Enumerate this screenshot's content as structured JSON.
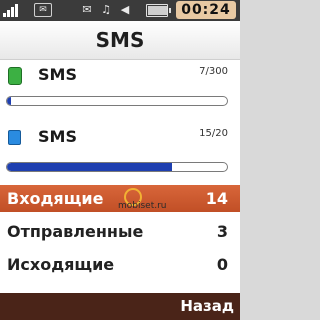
{
  "status_bar": {
    "time": "00:24",
    "signal_level": 4,
    "battery_level": 0.95,
    "icons": [
      "signal-icon",
      "message-indicator-icon",
      "mail-icon",
      "music-icon",
      "speaker-icon",
      "battery-icon"
    ]
  },
  "header": {
    "title": "SMS"
  },
  "storage": [
    {
      "label": "SMS",
      "count": "7/300",
      "icon": "phone-memory-icon",
      "fill_fraction": 0.02
    },
    {
      "label": "SMS",
      "count": "15/20",
      "icon": "sim-card-icon",
      "fill_fraction": 0.75
    }
  ],
  "folders": [
    {
      "label": "Входящие",
      "count": "14",
      "selected": true
    },
    {
      "label": "Отправленные",
      "count": "3",
      "selected": false
    },
    {
      "label": "Исходящие",
      "count": "0",
      "selected": false
    }
  ],
  "watermark": "mobiset.ru",
  "softkeys": {
    "right": "Назад"
  },
  "colors": {
    "selection": "#c9562c",
    "progress": "#1e3fb0",
    "softkey_bar": "#4a2418",
    "clock_bg": "#e8c9a3"
  }
}
